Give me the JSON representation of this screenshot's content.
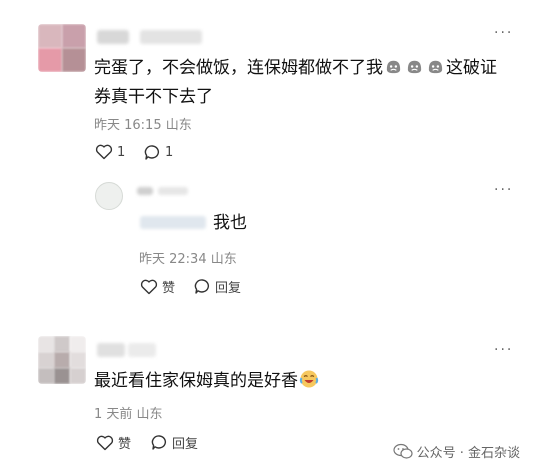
{
  "comments": [
    {
      "text_line1": "完蛋了，不会做饭，连保姆都做不了我",
      "text_line1_suffix": "这破证",
      "text_line2": "券真干不下去了",
      "time": "昨天 16:15",
      "location": "山东",
      "likes": "1",
      "replies": "1"
    },
    {
      "text": "最近看住家保姆真的是好香",
      "time": "1 天前",
      "location": "山东",
      "like_label": "赞",
      "reply_label": "回复"
    }
  ],
  "reply": {
    "text": "我也",
    "time": "昨天 22:34",
    "location": "山东",
    "like_label": "赞",
    "reply_label": "回复"
  },
  "more_glyph": "···",
  "watermark": {
    "text": "公众号 · 金石杂谈"
  }
}
